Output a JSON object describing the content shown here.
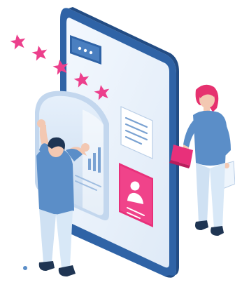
{
  "illustration": {
    "rating": {
      "stars": 5
    },
    "icons": {
      "chat": "chat-bubble-icon",
      "star": "star-icon",
      "profile": "user-profile-icon",
      "document": "document-lines-icon",
      "chart": "bar-chart-icon"
    },
    "colors": {
      "phone_frame": "#2f63a6",
      "phone_screen": "#e9f1fb",
      "accent_pink": "#e8307a",
      "star_pink": "#ec3f8c",
      "shirt_blue": "#5b8ec8",
      "pants_light": "#cfe1f3",
      "hair_dark": "#1f3553",
      "hair_pink": "#e6316f",
      "skin": "#f3c8b2",
      "card_light": "#d8e6f6"
    }
  }
}
